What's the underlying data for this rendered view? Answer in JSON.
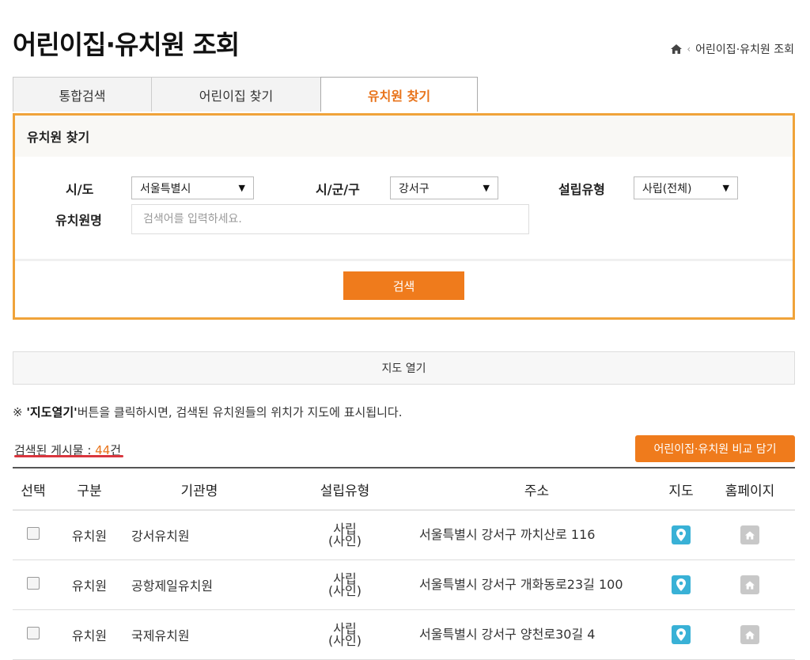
{
  "page": {
    "title": "어린이집·유치원 조회"
  },
  "breadcrumb": {
    "current": "어린이집·유치원 조회",
    "home_icon": "home-icon"
  },
  "tabs": [
    {
      "label": "통합검색",
      "active": false
    },
    {
      "label": "어린이집 찾기",
      "active": false
    },
    {
      "label": "유치원 찾기",
      "active": true
    }
  ],
  "search": {
    "heading": "유치원 찾기",
    "sido_label": "시/도",
    "sido_value": "서울특별시",
    "sigungu_label": "시/군/구",
    "sigungu_value": "강서구",
    "type_label": "설립유형",
    "type_value": "사립(전체)",
    "name_label": "유치원명",
    "name_placeholder": "검색어를 입력하세요.",
    "button": "검색"
  },
  "map_button": "지도 열기",
  "notice": {
    "prefix": "※ ",
    "emph": "'지도열기'",
    "rest": "버튼을 클릭하시면, 검색된 유치원들의 위치가 지도에 표시됩니다."
  },
  "results": {
    "count_label": "검색된 게시물 : ",
    "count_value": "44",
    "count_unit": "건",
    "compare_button": "어린이집·유치원 비교 담기",
    "columns": [
      "선택",
      "구분",
      "기관명",
      "설립유형",
      "주소",
      "지도",
      "홈페이지"
    ],
    "rows": [
      {
        "kind": "유치원",
        "name": "강서유치원",
        "type_top": "사립",
        "type_bottom": "(사인)",
        "address": "서울특별시 강서구 까치산로 116"
      },
      {
        "kind": "유치원",
        "name": "공항제일유치원",
        "type_top": "사립",
        "type_bottom": "(사인)",
        "address": "서울특별시 강서구 개화동로23길 100"
      },
      {
        "kind": "유치원",
        "name": "국제유치원",
        "type_top": "사립",
        "type_bottom": "(사인)",
        "address": "서울특별시 강서구 양천로30길 4"
      }
    ]
  },
  "colors": {
    "accent": "#ef7b1c",
    "border": "#f0a33a",
    "map_pin": "#39b1d6",
    "underline": "#d9363e"
  }
}
